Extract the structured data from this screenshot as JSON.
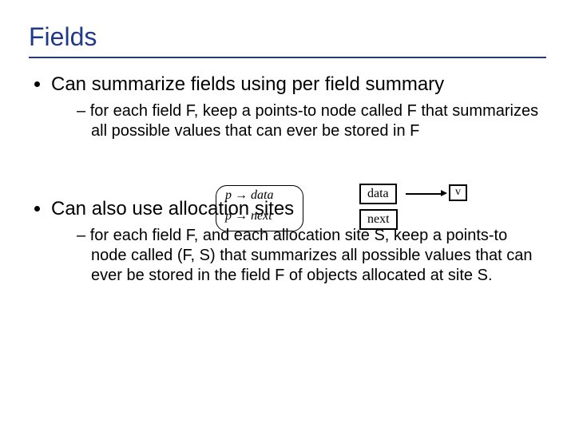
{
  "title": "Fields",
  "bullets": {
    "b1": "Can summarize fields using per field summary",
    "b1_sub": "for each field F, keep a points-to node called F that summarizes all possible values that can ever be stored in F",
    "b2": "Can also use allocation sites",
    "b2_sub": "for each field F, and each allocation site S, keep a points-to node called (F, S) that summarizes all possible values that can ever be stored in the field F of objects allocated at site S."
  },
  "sketch": {
    "p_data": "p → data",
    "p_next": "p → next",
    "box_data": "data",
    "box_next": "next",
    "box_v": "v"
  }
}
